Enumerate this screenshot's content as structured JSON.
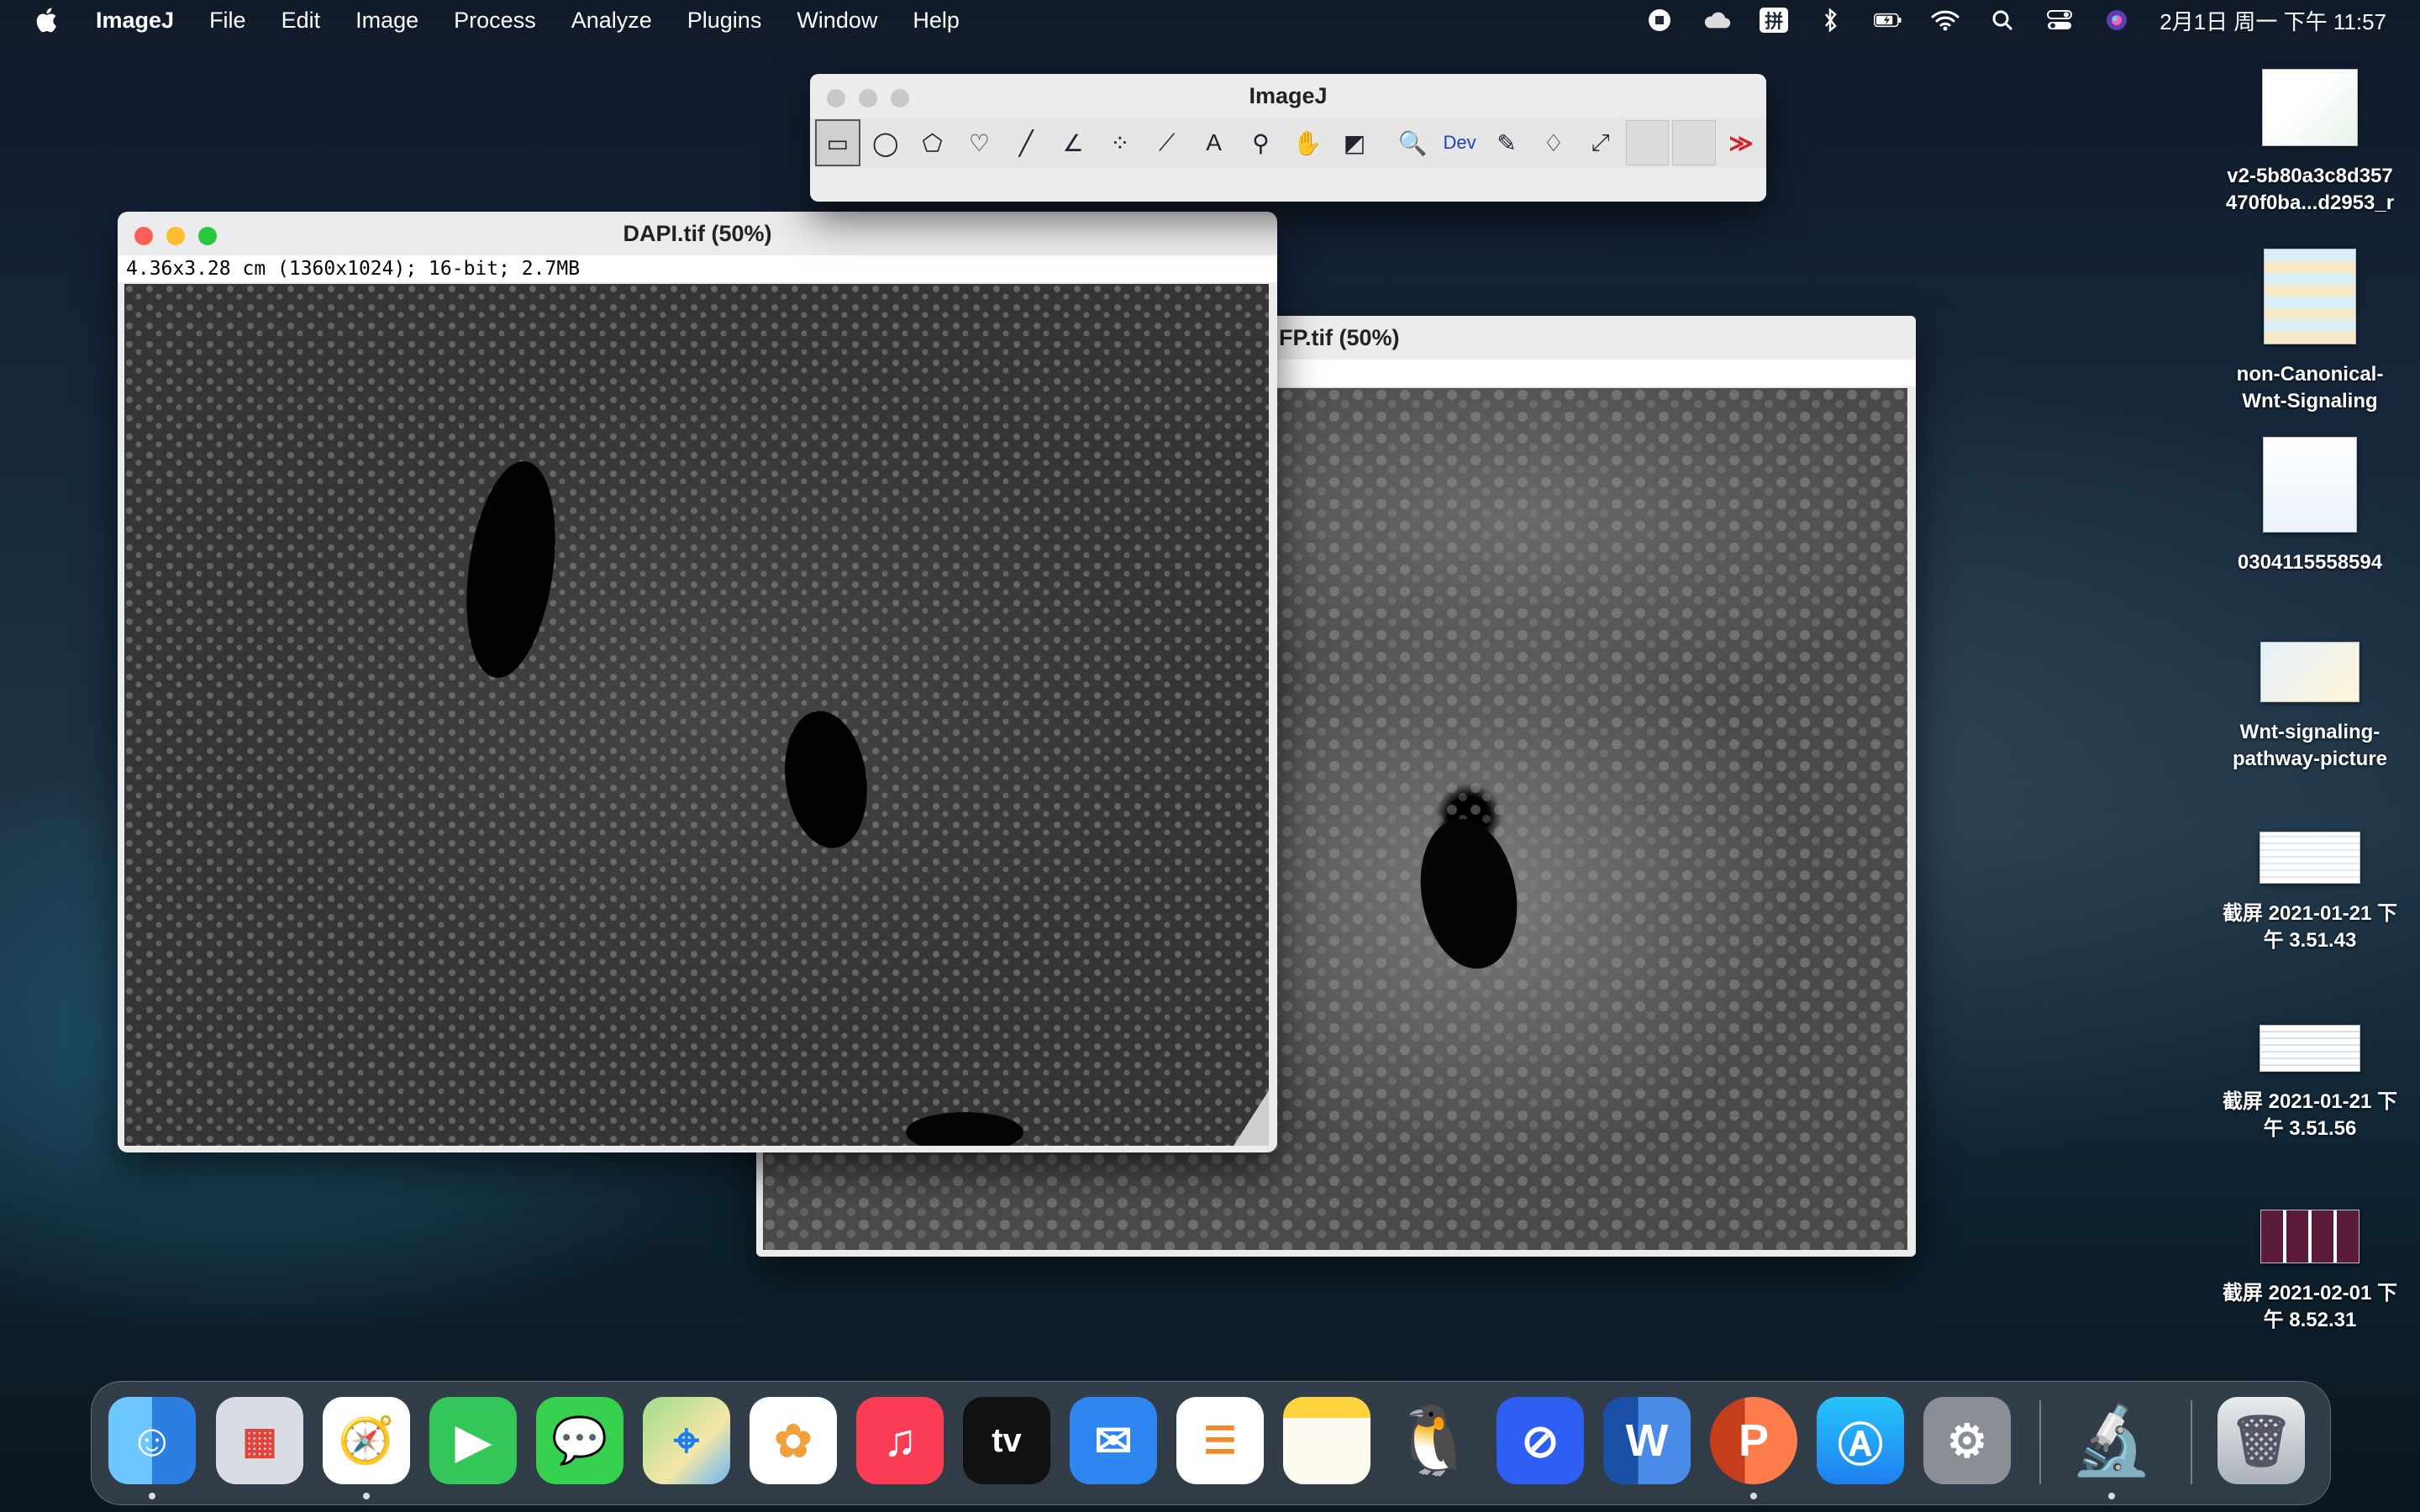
{
  "menubar": {
    "app_name": "ImageJ",
    "items": [
      "File",
      "Edit",
      "Image",
      "Process",
      "Analyze",
      "Plugins",
      "Window",
      "Help"
    ],
    "clock": "2月1日 周一 下午 11:57",
    "status_icons": [
      "stop-record-icon",
      "cloud-icon",
      "input-method-icon",
      "bluetooth-icon",
      "battery-icon",
      "wifi-icon",
      "spotlight-search-icon",
      "control-center-icon",
      "siri-icon"
    ],
    "input_method_label": "拼"
  },
  "toolbar_window": {
    "title": "ImageJ",
    "tools": [
      {
        "name": "rectangle-tool",
        "glyph": "▭",
        "active": true
      },
      {
        "name": "oval-tool",
        "glyph": "◯"
      },
      {
        "name": "polygon-tool",
        "glyph": "⬠"
      },
      {
        "name": "freehand-tool",
        "glyph": "♡"
      },
      {
        "name": "line-tool",
        "glyph": "╱"
      },
      {
        "name": "angle-tool",
        "glyph": "∠"
      },
      {
        "name": "point-tool",
        "glyph": "⁘"
      },
      {
        "name": "wand-tool",
        "glyph": "⟋"
      },
      {
        "name": "text-tool",
        "glyph": "A"
      },
      {
        "name": "zoom-tool",
        "glyph": "⚲"
      },
      {
        "name": "hand-tool",
        "glyph": "✋"
      },
      {
        "name": "color-picker-tool",
        "glyph": "◩"
      },
      {
        "name": "magnifier-tool",
        "glyph": "🔍"
      },
      {
        "name": "dev-tool",
        "glyph": "Dev"
      },
      {
        "name": "brush-tool",
        "glyph": "✎"
      },
      {
        "name": "flood-fill-tool",
        "glyph": "♢"
      },
      {
        "name": "pipette-tool",
        "glyph": "⤢"
      },
      {
        "name": "empty-slot-1",
        "glyph": ""
      },
      {
        "name": "empty-slot-2",
        "glyph": ""
      },
      {
        "name": "more-tools",
        "glyph": "≫"
      }
    ]
  },
  "dapi_window": {
    "title": "DAPI.tif (50%)",
    "info": "4.36x3.28 cm (1360x1024); 16-bit; 2.7MB"
  },
  "gfp_window": {
    "title": "FP.tif (50%)"
  },
  "desktop_icons": [
    {
      "label_line1": "v2-5b80a3c8d357",
      "label_line2": "470f0ba...d2953_r"
    },
    {
      "label_line1": "non-Canonical-",
      "label_line2": "Wnt-Signaling"
    },
    {
      "label_line1": "0304115558594",
      "label_line2": ""
    },
    {
      "label_line1": "Wnt-signaling-",
      "label_line2": "pathway-picture"
    },
    {
      "label_line1": "截屏 2021-01-21 下",
      "label_line2": "午 3.51.43"
    },
    {
      "label_line1": "截屏 2021-01-21 下",
      "label_line2": "午 3.51.56"
    },
    {
      "label_line1": "截屏 2021-02-01 下",
      "label_line2": "午 8.52.31"
    }
  ],
  "dock": {
    "apps": [
      "finder",
      "launchpad",
      "safari",
      "facetime",
      "messages",
      "maps",
      "photos",
      "music",
      "apple-tv",
      "mail",
      "reminders",
      "notes",
      "qq",
      "shadowrocket",
      "word",
      "powerpoint",
      "app-store",
      "system-preferences",
      "imagej",
      "trash"
    ],
    "tv_label": "tv",
    "word_label": "W",
    "powerpoint_label": "P"
  }
}
